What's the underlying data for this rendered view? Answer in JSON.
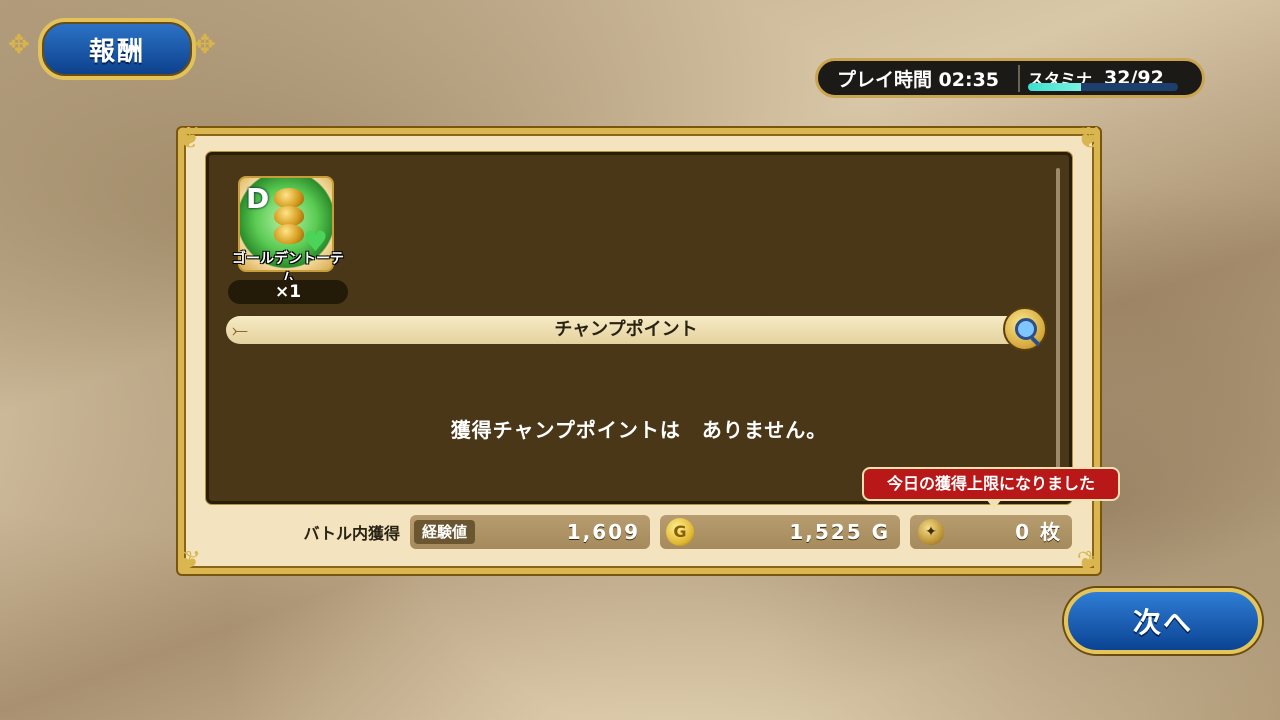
{
  "header": {
    "title": "報酬"
  },
  "status": {
    "playtime": "プレイ時間 02:35",
    "stamina_label": "スタミナ",
    "stamina_value": "32/92",
    "stamina_fraction": 0.35
  },
  "reward_item": {
    "rank": "D",
    "name": "ゴールデントーテム",
    "quantity": "×1"
  },
  "champ_section": {
    "header": "チャンプポイント",
    "message": "獲得チャンプポイントは　ありません。"
  },
  "limit_notice": "今日の獲得上限になりました",
  "battle_earnings": {
    "label": "バトル内獲得",
    "exp_tag": "経験値",
    "exp_value": "1,609",
    "gold_icon_glyph": "G",
    "gold_value": "1,525 G",
    "medal_value": "0 枚"
  },
  "next_button": "次へ",
  "colors": {
    "accent_gold": "#d9b64f",
    "button_blue": "#0b4393",
    "notice_red": "#b81818"
  }
}
